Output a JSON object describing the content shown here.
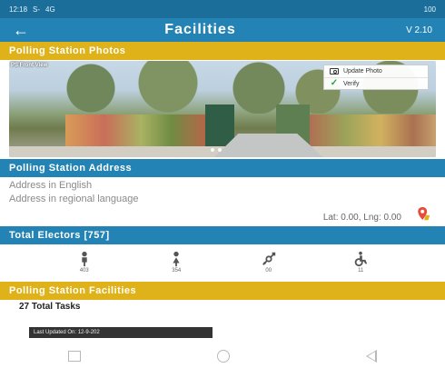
{
  "status_bar": {
    "time": "12:18",
    "signal": "S-",
    "network": "4G",
    "battery": "100"
  },
  "app": {
    "title": "Facilities",
    "version": "V 2.10"
  },
  "sections": {
    "photos": "Polling Station Photos",
    "address": "Polling Station Address",
    "electors": "Total Electors [757]",
    "facilities": "Polling Station Facilities"
  },
  "photo": {
    "label": "PS Front View",
    "actions": [
      {
        "label": "Update Photo",
        "icon": "camera-icon"
      },
      {
        "label": "Verify",
        "icon": "check-icon"
      }
    ]
  },
  "address": {
    "english": "Address in English",
    "regional": "Address in regional language",
    "latlng": "Lat: 0.00, Lng: 0.00"
  },
  "elector_stats": [
    {
      "icon": "male-icon",
      "value": "403"
    },
    {
      "icon": "female-icon",
      "value": "354"
    },
    {
      "icon": "third-gender-icon",
      "value": "00"
    },
    {
      "icon": "disabled-icon",
      "value": "11"
    }
  ],
  "facilities": {
    "total_tasks": "27 Total Tasks",
    "last_updated": "Last Updated On: 12-9-202"
  },
  "colors": {
    "primary": "#2383b5",
    "status": "#1b6d9a",
    "accent": "#e0b21a",
    "map_pin": "#e84a3c"
  }
}
